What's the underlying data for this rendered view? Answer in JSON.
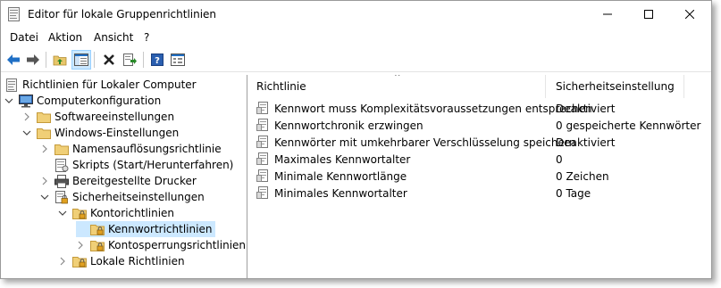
{
  "window": {
    "title": "Editor für lokale Gruppenrichtlinien"
  },
  "menu": {
    "items": [
      "Datei",
      "Aktion",
      "Ansicht",
      "?"
    ]
  },
  "toolbar": {
    "buttons": [
      "back-icon",
      "forward-icon",
      "folder-up-icon",
      "show-hide-tree-icon",
      "delete-icon",
      "export-list-icon",
      "help-icon",
      "properties-icon"
    ]
  },
  "tree": {
    "items": [
      {
        "label": "Richtlinien für Lokaler Computer",
        "icon": "policy-doc-icon",
        "level": 0,
        "expander": "none"
      },
      {
        "label": "Computerkonfiguration",
        "icon": "computer-icon",
        "level": 0,
        "expander": "expanded"
      },
      {
        "label": "Softwareeinstellungen",
        "icon": "folder-icon",
        "level": 1,
        "expander": "collapsed"
      },
      {
        "label": "Windows-Einstellungen",
        "icon": "folder-icon",
        "level": 1,
        "expander": "expanded"
      },
      {
        "label": "Namensauflösungsrichtlinie",
        "icon": "folder-icon",
        "level": 2,
        "expander": "collapsed"
      },
      {
        "label": "Skripts (Start/Herunterfahren)",
        "icon": "script-icon",
        "level": 2,
        "expander": "none"
      },
      {
        "label": "Bereitgestellte Drucker",
        "icon": "printer-icon",
        "level": 2,
        "expander": "collapsed"
      },
      {
        "label": "Sicherheitseinstellungen",
        "icon": "security-icon",
        "level": 2,
        "expander": "expanded"
      },
      {
        "label": "Kontorichtlinien",
        "icon": "lock-folder-icon",
        "level": 3,
        "expander": "expanded"
      },
      {
        "label": "Kennwortrichtlinien",
        "icon": "lock-folder-icon",
        "level": 4,
        "expander": "none",
        "selected": true
      },
      {
        "label": "Kontosperrungsrichtlinien",
        "icon": "lock-folder-icon",
        "level": 4,
        "expander": "collapsed"
      },
      {
        "label": "Lokale Richtlinien",
        "icon": "lock-folder-icon",
        "level": 3,
        "expander": "collapsed"
      }
    ]
  },
  "list": {
    "columns": [
      "Richtlinie",
      "Sicherheitseinstellung"
    ],
    "sort_indicator": "^",
    "rows": [
      {
        "policy": "Kennwort muss Komplexitätsvoraussetzungen entsprechen",
        "value": "Deaktiviert"
      },
      {
        "policy": "Kennwortchronik erzwingen",
        "value": "0 gespeicherte Kennwörter"
      },
      {
        "policy": "Kennwörter mit umkehrbarer Verschlüsselung speichern",
        "value": "Deaktiviert"
      },
      {
        "policy": "Maximales Kennwortalter",
        "value": "0"
      },
      {
        "policy": "Minimale Kennwortlänge",
        "value": "0 Zeichen"
      },
      {
        "policy": "Minimales Kennwortalter",
        "value": "0 Tage"
      }
    ]
  },
  "colors": {
    "selection": "#cce8ff",
    "folder": "#e8c66a",
    "accent_blue": "#1f6fc5"
  }
}
